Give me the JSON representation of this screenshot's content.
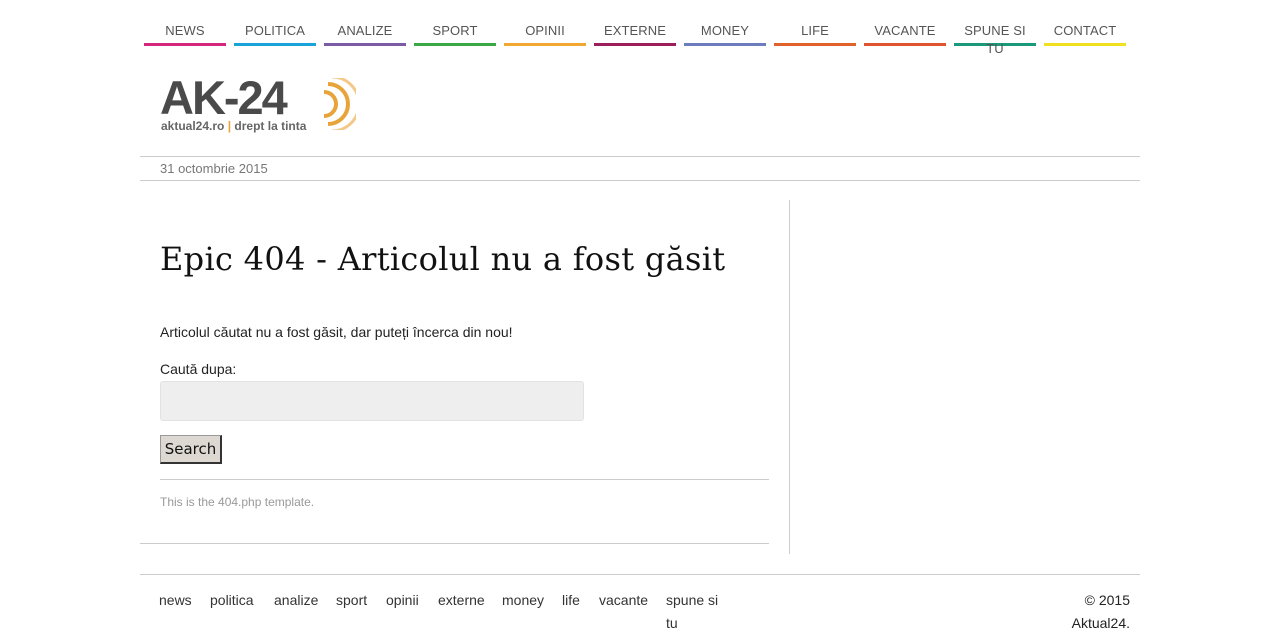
{
  "nav": {
    "items": [
      {
        "label": "NEWS",
        "color": "#d4267d"
      },
      {
        "label": "POLITICA",
        "color": "#1aa3d8"
      },
      {
        "label": "ANALIZE",
        "color": "#7b5aa6"
      },
      {
        "label": "SPORT",
        "color": "#3aa845"
      },
      {
        "label": "OPINII",
        "color": "#f0a830"
      },
      {
        "label": "EXTERNE",
        "color": "#9c1f5c"
      },
      {
        "label": "MONEY",
        "color": "#6b7cbf"
      },
      {
        "label": "LIFE",
        "color": "#e0622a"
      },
      {
        "label": "VACANTE",
        "color": "#e0552e"
      },
      {
        "label": "SPUNE SI TU",
        "color": "#1a9a7a"
      },
      {
        "label": "CONTACT",
        "color": "#f0e020"
      }
    ]
  },
  "logo": {
    "mark": "AK-24",
    "domain": "aktual24.ro",
    "separator": "|",
    "tagline": "drept la tinta",
    "accent_color": "#e8a33b"
  },
  "date": "31 octombrie 2015",
  "main": {
    "title": "Epic 404 - Articolul nu a fost găsit",
    "intro": "Articolul căutat nu a fost găsit, dar puteți încerca din nou!",
    "search_label": "Caută dupa:",
    "search_value": "",
    "search_button": "Search",
    "template_note": "This is the 404.php template."
  },
  "footer": {
    "links": [
      "news",
      "politica",
      "analize",
      "sport",
      "opinii",
      "externe",
      "money",
      "life",
      "vacante",
      "spune si tu"
    ],
    "copyright": "© 2015 Aktual24."
  }
}
